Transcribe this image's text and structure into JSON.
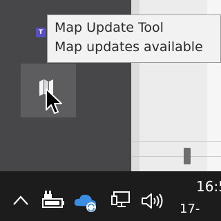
{
  "tooltip": {
    "title": "Map Update Tool",
    "message": "Map updates available"
  },
  "tray_overflow": {
    "mini_app_glyph": "T",
    "hovered_icon": "map-icon"
  },
  "taskbar": {
    "icons": [
      "chevron-up-icon",
      "battery-charging-icon",
      "onedrive-sync-icon",
      "network-icon",
      "volume-icon"
    ],
    "clock_time": "16:5",
    "clock_date": "17-"
  },
  "colors": {
    "taskbar": "#1c1c1c",
    "tray_panel": "#474749",
    "tooltip_bg": "#f2f2f2",
    "onedrive_blue": "#3a8de0"
  }
}
